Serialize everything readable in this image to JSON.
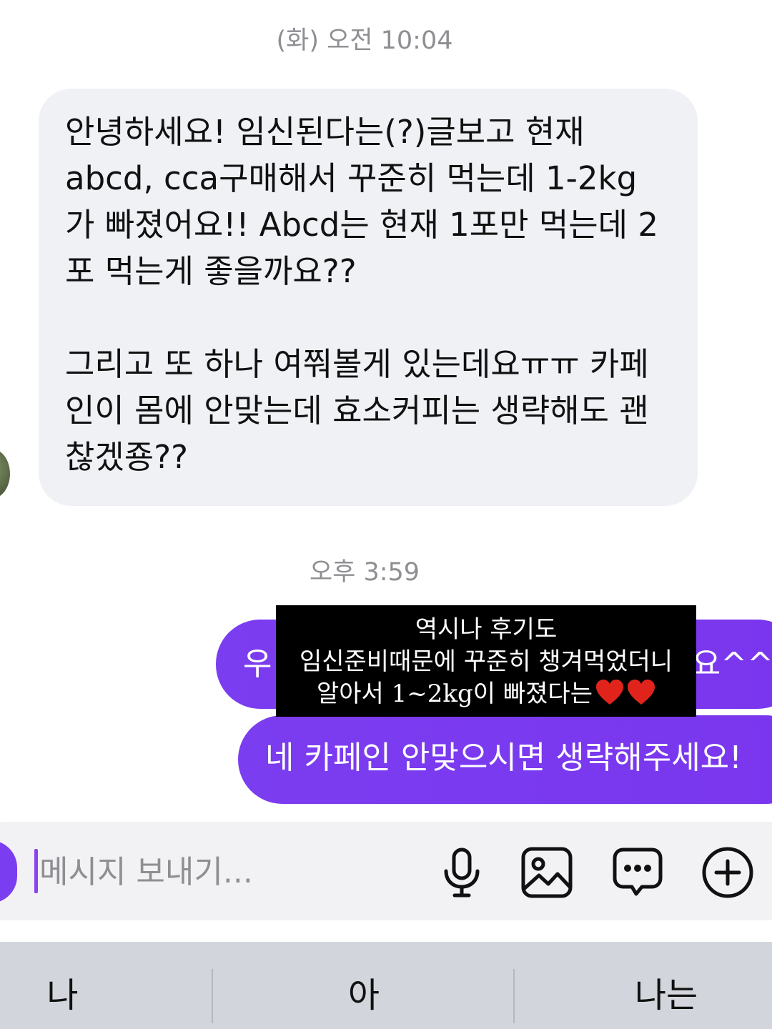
{
  "chat": {
    "timestamp_1": "(화) 오전 10:04",
    "incoming_message": {
      "paragraph_1": "안녕하세요! 임신된다는(?)글보고 현재 abcd, cca구매해서 꾸준히 먹는데 1-2kg 가 빠졌어요!! Abcd는 현재 1포만 먹는데 2포 먹는게 좋을까요??",
      "paragraph_2": "그리고 또 하나 여쭤볼게 있는데요ㅠㅠ 카페인이 몸에 안맞는데 효소커피는 생략해도 괜찮겠죵??"
    },
    "timestamp_2": "오후 3:59",
    "outgoing_messages": [
      {
        "visible_start": "우",
        "visible_end": "요^^"
      },
      {
        "text": "네 카페인 안맞으시면 생략해주세요!"
      }
    ]
  },
  "caption_overlay": {
    "line_1": "역시나 후기도",
    "line_2": "임신준비때문에 꾸준히 챙겨먹었더니",
    "line_3": "알아서 1~2kg이 빠졌다는",
    "heart_color": "#e0241b"
  },
  "composer": {
    "placeholder": "메시지 보내기...",
    "icons": [
      "microphone-icon",
      "image-icon",
      "sticker-icon",
      "plus-icon"
    ]
  },
  "keyboard": {
    "suggestions": [
      "나",
      "아",
      "나는"
    ]
  },
  "colors": {
    "outgoing_bubble": "#7b3df0",
    "incoming_bubble": "#eff1f5",
    "keyboard_bar": "#d2d5dc"
  }
}
